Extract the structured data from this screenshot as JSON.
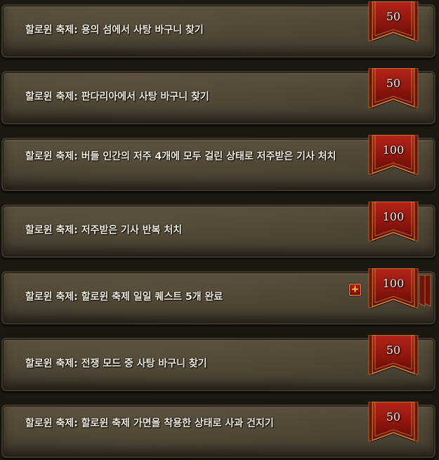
{
  "achievements": [
    {
      "title": "할로윈 축제: 용의 섬에서 사탕 바구니 찾기",
      "points": "50",
      "stacked": false
    },
    {
      "title": "할로윈 축제: 판다리아에서 사탕 바구니 찾기",
      "points": "50",
      "stacked": false
    },
    {
      "title": "할로윈 축제: 버들 인간의 저주 4개에 모두 걸린 상태로 저주받은 기사 처치",
      "points": "100",
      "stacked": false
    },
    {
      "title": "할로윈 축제: 저주받은 기사 반복 처치",
      "points": "100",
      "stacked": false
    },
    {
      "title": "할로윈 축제: 할로윈 축제 일일 퀘스트 5개 완료",
      "points": "100",
      "stacked": true,
      "expand_icon": "plus-icon",
      "expand_label": "+"
    },
    {
      "title": "할로윈 축제: 전쟁 모드 중 사탕 바구니 찾기",
      "points": "50",
      "stacked": false
    },
    {
      "title": "할로윈 축제: 할로윈 축제 가면을 착용한 상태로 사과 건지기",
      "points": "50",
      "stacked": false
    }
  ],
  "colors": {
    "banner_red": "#9b1a10",
    "banner_gold": "#d3a047",
    "text": "#f1ebdc"
  }
}
